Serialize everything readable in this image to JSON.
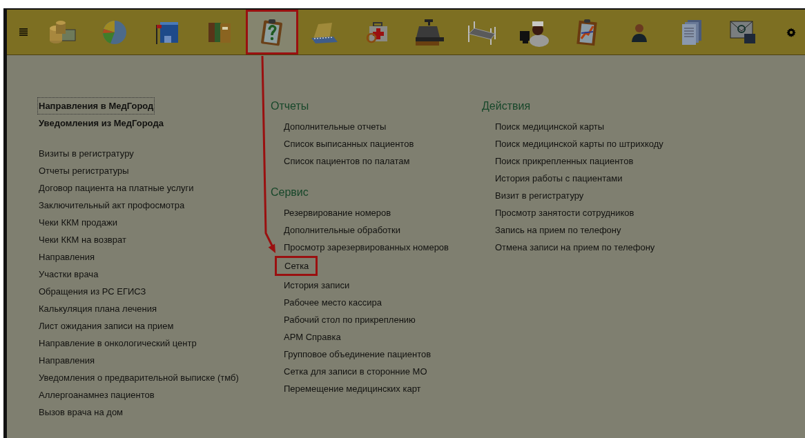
{
  "toolbar": {
    "sections": [
      {
        "selected": false,
        "highlighted": false
      },
      {
        "selected": false,
        "highlighted": false
      },
      {
        "selected": false,
        "highlighted": false
      },
      {
        "selected": false,
        "highlighted": false
      },
      {
        "selected": true,
        "highlighted": true
      },
      {
        "selected": false,
        "highlighted": false
      },
      {
        "selected": false,
        "highlighted": false
      },
      {
        "selected": false,
        "highlighted": false
      },
      {
        "selected": false,
        "highlighted": false
      },
      {
        "selected": false,
        "highlighted": false
      },
      {
        "selected": false,
        "highlighted": false
      },
      {
        "selected": false,
        "highlighted": false
      },
      {
        "selected": false,
        "highlighted": false
      },
      {
        "selected": false,
        "highlighted": false
      }
    ]
  },
  "columns": [
    {
      "groups": [
        {
          "kind": "important",
          "items": [
            {
              "text": "Направления в МедГород",
              "focused": true
            },
            {
              "text": "Уведомления из МедГорода",
              "focused": false
            }
          ]
        },
        {
          "kind": "plain",
          "items": [
            {
              "text": "Визиты в регистратуру",
              "focused": false
            },
            {
              "text": "Отчеты регистратуры",
              "focused": false
            },
            {
              "text": "Договор пациента на платные услуги",
              "focused": false
            },
            {
              "text": "Заключительный акт профосмотра",
              "focused": false
            },
            {
              "text": "Чеки ККМ продажи",
              "focused": false
            },
            {
              "text": "Чеки ККМ на возврат",
              "focused": false
            },
            {
              "text": "Направления",
              "focused": false
            },
            {
              "text": "Участки врача",
              "focused": false
            },
            {
              "text": "Обращения из РС ЕГИСЗ",
              "focused": false
            },
            {
              "text": "Калькуляция плана лечения",
              "focused": false
            },
            {
              "text": "Лист ожидания записи на прием",
              "focused": false
            },
            {
              "text": "Направление в онкологический центр",
              "focused": false
            },
            {
              "text": "Направления",
              "focused": false
            },
            {
              "text": "Уведомления о предварительной выписке (тмб)",
              "focused": false
            },
            {
              "text": "Аллергоанамнез пациентов",
              "focused": false
            },
            {
              "text": "Вызов врача на дом",
              "focused": false
            }
          ]
        }
      ]
    },
    {
      "groups": [
        {
          "kind": "section",
          "title": "Отчеты",
          "items": [
            {
              "text": "Дополнительные отчеты",
              "highlighted": false
            },
            {
              "text": "Список выписанных пациентов",
              "highlighted": false
            },
            {
              "text": "Список пациентов по палатам",
              "highlighted": false
            }
          ]
        },
        {
          "kind": "section",
          "title": "Сервис",
          "items": [
            {
              "text": "Резервирование номеров",
              "highlighted": false
            },
            {
              "text": "Дополнительные обработки",
              "highlighted": false
            },
            {
              "text": "Просмотр зарезервированных номеров",
              "highlighted": false
            },
            {
              "text": "Сетка",
              "highlighted": true
            },
            {
              "text": "История записи",
              "highlighted": false
            },
            {
              "text": "Рабочее место кассира",
              "highlighted": false
            },
            {
              "text": "Рабочий стол по прикреплению",
              "highlighted": false
            },
            {
              "text": "АРМ Справка",
              "highlighted": false
            },
            {
              "text": "Групповое объединение пациентов",
              "highlighted": false
            },
            {
              "text": "Сетка для записи в сторонние МО",
              "highlighted": false
            },
            {
              "text": "Перемещение медицинских карт",
              "highlighted": false
            }
          ]
        }
      ]
    },
    {
      "groups": [
        {
          "kind": "section",
          "title": "Действия",
          "items": [
            {
              "text": "Поиск медицинской карты",
              "highlighted": false
            },
            {
              "text": "Поиск медицинской карты по штрихкоду",
              "highlighted": false
            },
            {
              "text": "Поиск прикрепленных пациентов",
              "highlighted": false
            },
            {
              "text": "История работы с пациентами",
              "highlighted": false
            },
            {
              "text": "Визит в регистратуру",
              "highlighted": false
            },
            {
              "text": "Просмотр занятости сотрудников",
              "highlighted": false
            },
            {
              "text": "Запись на прием по телефону",
              "highlighted": false
            },
            {
              "text": "Отмена записи на прием по телефону",
              "highlighted": false
            }
          ]
        }
      ]
    }
  ]
}
